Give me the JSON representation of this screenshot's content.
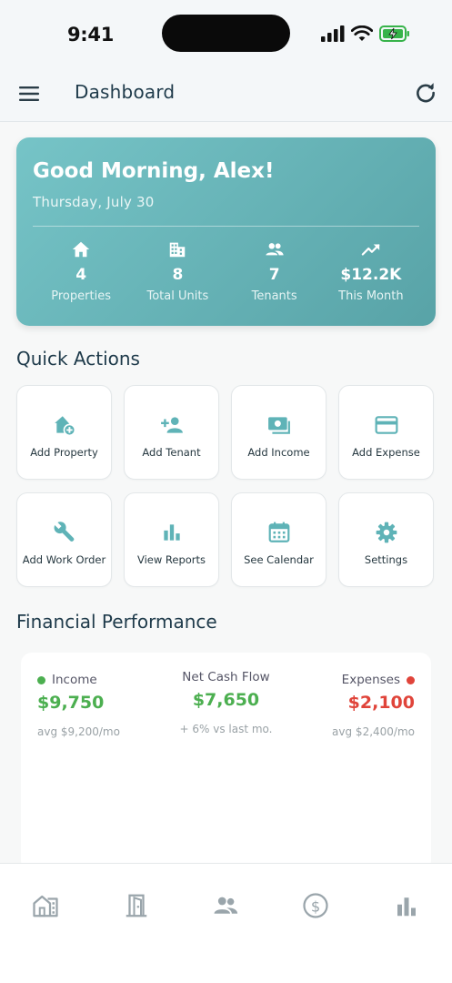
{
  "status_bar": {
    "time": "9:41"
  },
  "header": {
    "title": "Dashboard"
  },
  "hero": {
    "greeting": "Good Morning, Alex!",
    "date": "Thursday, July 30",
    "stats": [
      {
        "icon": "home-icon",
        "value": "4",
        "label": "Properties"
      },
      {
        "icon": "building-icon",
        "value": "8",
        "label": "Total Units"
      },
      {
        "icon": "people-icon",
        "value": "7",
        "label": "Tenants"
      },
      {
        "icon": "trending-up-icon",
        "value": "$12.2K",
        "label": "This Month"
      }
    ]
  },
  "quick_actions": {
    "title": "Quick Actions",
    "items": [
      {
        "icon": "add-home-icon",
        "label": "Add Property"
      },
      {
        "icon": "person-add-icon",
        "label": "Add Tenant"
      },
      {
        "icon": "cash-icon",
        "label": "Add Income"
      },
      {
        "icon": "credit-card-icon",
        "label": "Add Expense"
      },
      {
        "icon": "wrench-icon",
        "label": "Add Work Order"
      },
      {
        "icon": "bar-chart-icon",
        "label": "View Reports"
      },
      {
        "icon": "calendar-icon",
        "label": "See Calendar"
      },
      {
        "icon": "gear-icon",
        "label": "Settings"
      }
    ]
  },
  "financial": {
    "title": "Financial Performance",
    "income": {
      "label": "Income",
      "amount": "$9,750",
      "sub": "avg $9,200/mo"
    },
    "net": {
      "label": "Net Cash Flow",
      "amount": "$7,650",
      "sub": "+ 6% vs last mo."
    },
    "expenses": {
      "label": "Expenses",
      "amount": "$2,100",
      "sub": "avg $2,400/mo"
    }
  },
  "bottom_nav": [
    "properties-icon",
    "units-icon",
    "tenants-icon",
    "finance-icon",
    "reports-icon"
  ],
  "colors": {
    "accent": "#5fb3b7",
    "income": "#4caf50",
    "expense": "#e0443a",
    "text_dark": "#1e3a4a",
    "nav_icon": "#9aa5ab"
  }
}
